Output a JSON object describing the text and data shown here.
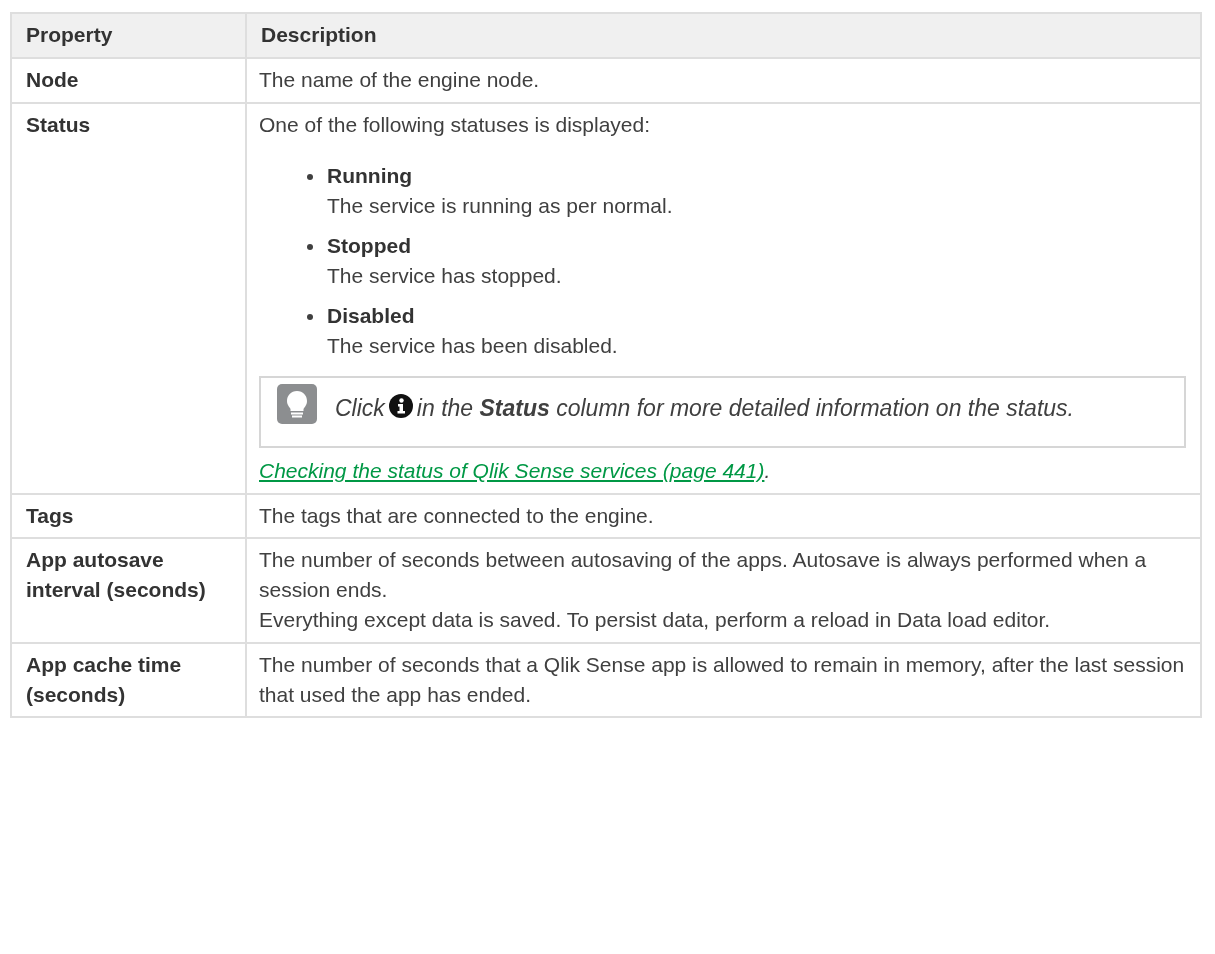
{
  "table": {
    "columns": [
      "Property",
      "Description"
    ],
    "rows": [
      {
        "property": "Node",
        "blocks": [
          {
            "kind": "paragraph",
            "text": "The name of the engine node."
          }
        ]
      },
      {
        "property": "Status",
        "blocks": [
          {
            "kind": "paragraph",
            "text": "One of the following statuses is displayed:"
          },
          {
            "kind": "bullets",
            "items": [
              {
                "term": "Running",
                "text": "The service is running as per normal."
              },
              {
                "term": "Stopped",
                "text": "The service has stopped."
              },
              {
                "term": "Disabled",
                "text": "The service has been disabled."
              }
            ]
          },
          {
            "kind": "tip",
            "before": "Click",
            "after": "in the **Status** column for more detailed information on the status."
          },
          {
            "kind": "link",
            "text": "Checking the status of Qlik Sense services (page 441)",
            "after": "."
          }
        ]
      },
      {
        "property": "Tags",
        "blocks": [
          {
            "kind": "paragraph",
            "text": "The tags that are connected to the engine."
          }
        ]
      },
      {
        "property": "App autosave interval (seconds)",
        "blocks": [
          {
            "kind": "paragraph",
            "text": "The number of seconds between autosaving of the apps. Autosave is always performed when a session ends."
          },
          {
            "kind": "paragraph",
            "text": "Everything except data is saved. To persist data, perform a reload in Data load editor."
          }
        ]
      },
      {
        "property": "App cache time (seconds)",
        "blocks": [
          {
            "kind": "paragraph",
            "text": "The number of seconds that a Qlik Sense app is allowed to remain in memory, after the last session that used the app has ended."
          }
        ]
      }
    ]
  }
}
